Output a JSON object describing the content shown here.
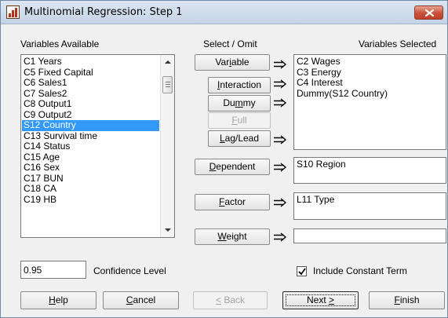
{
  "window": {
    "title": "Multinomial Regression: Step 1",
    "icon": "app-icon",
    "close_icon": "close-icon"
  },
  "labels": {
    "variables_available": "Variables Available",
    "select_omit": "Select / Omit",
    "variables_selected": "Variables Selected",
    "confidence_level": "Confidence Level",
    "include_constant_term": "Include Constant Term"
  },
  "variables_available": {
    "items": [
      "C1 Years",
      "C5 Fixed Capital",
      "C6 Sales1",
      "C7 Sales2",
      "C8 Output1",
      "C9 Output2",
      "S12 Country",
      "C13 Survival time",
      "C14 Status",
      "C15 Age",
      "C16 Sex",
      "C17 BUN",
      "C18 CA",
      "C19 HB"
    ],
    "selected": "S12 Country"
  },
  "selected_variables": [
    "C2 Wages",
    "C3 Energy",
    "C4 Interest",
    "Dummy(S12 Country)"
  ],
  "dependent": "S10 Region",
  "factor": "L11 Type",
  "weight": "",
  "confidence_level": "0.95",
  "include_constant_term": true,
  "buttons": {
    "variable": {
      "pre": "Var",
      "key": "i",
      "post": "able"
    },
    "interaction": {
      "pre": "",
      "key": "I",
      "post": "nteraction"
    },
    "dummy": {
      "pre": "Du",
      "key": "m",
      "post": "my"
    },
    "full": {
      "pre": "",
      "key": "F",
      "post": "ull"
    },
    "laglead": {
      "pre": "",
      "key": "L",
      "post": "ag/Lead"
    },
    "dependent": {
      "pre": "",
      "key": "D",
      "post": "ependent"
    },
    "factor": {
      "pre": "",
      "key": "F",
      "post": "actor"
    },
    "weight": {
      "pre": "",
      "key": "W",
      "post": "eight"
    },
    "help": {
      "pre": "",
      "key": "H",
      "post": "elp"
    },
    "cancel": {
      "pre": "",
      "key": "C",
      "post": "ancel"
    },
    "back": {
      "pre": "",
      "key": "<",
      "post": " Back"
    },
    "next": {
      "pre": "Next ",
      "key": ">",
      "post": ""
    },
    "finish": {
      "pre": "",
      "key": "F",
      "post": "inish"
    }
  },
  "colors": {
    "selection": "#3399ff",
    "window_bg": "#f0f0f0",
    "title_bar": "#c4d3e6",
    "close_button": "#c9503a"
  }
}
